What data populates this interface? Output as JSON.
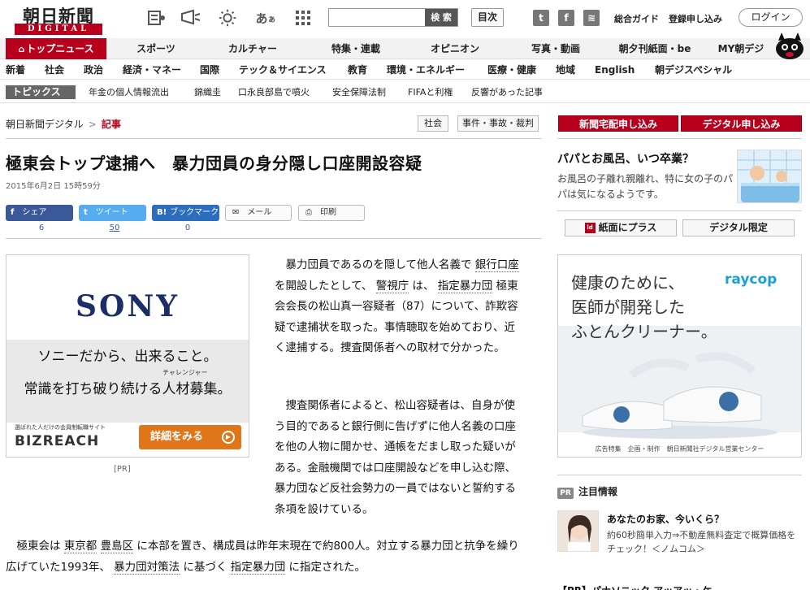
{
  "header": {
    "logo_main": "朝日新聞",
    "logo_sub": "DIGITAL",
    "search_placeholder": "",
    "search_button": "検 索",
    "index_button": "目次",
    "sns_twitter": "t",
    "sns_facebook": "f",
    "sns_rss": "≋",
    "guide_link": "総合ガイド",
    "subscribe_link": "登録申し込み",
    "login_button": "ログイン"
  },
  "main_nav": {
    "items": [
      "トップニュース",
      "スポーツ",
      "カルチャー",
      "特集・連載",
      "オピニオン",
      "写真・動画",
      "朝夕刊紙面・be",
      "MY朝デジ"
    ]
  },
  "sub_nav": {
    "items": [
      "新着",
      "社会",
      "政治",
      "経済・マネー",
      "国際",
      "テック＆サイエンス",
      "教育",
      "環境・エネルギー",
      "医療・健康",
      "地域",
      "English",
      "朝デジスペシャル"
    ]
  },
  "topics": {
    "label": "トピックス",
    "items": [
      "年金の個人情報流出",
      "錦織圭",
      "口永良部島で噴火",
      "安全保障法制",
      "FIFAと利権",
      "反響があった記事"
    ]
  },
  "breadcrumb": {
    "home": "朝日新聞デジタル",
    "separator": ">",
    "current": "記事"
  },
  "categories": [
    "社会",
    "事件・事故・裁判"
  ],
  "article": {
    "headline": "極東会トップ逮捕へ　暴力団員の身分隠し口座開設容疑",
    "date": "2015年6月2日 15時59分",
    "share_fb": "シェア",
    "share_fb_glyph": "f",
    "share_fb_count": "6",
    "share_tw": "ツイート",
    "share_tw_glyph": "t",
    "share_tw_count": "50",
    "share_hb": "ブックマーク",
    "share_hb_glyph": "B!",
    "share_hb_count": "0",
    "mail": "メール",
    "mail_glyph": "✉",
    "print": "印刷",
    "print_glyph": "⎙",
    "p1": [
      {
        "t": "　暴力団員であるのを隠して他人名義で "
      },
      {
        "t": "銀行口座",
        "kw": true
      },
      {
        "t": " を開設したとして、 "
      },
      {
        "t": "警視庁",
        "kw": true
      },
      {
        "t": " は、 "
      },
      {
        "t": "指定暴力団",
        "kw": true
      },
      {
        "t": " 極東会会長の松山真一容疑者（87）について、詐欺容疑で逮捕状を取った。事情聴取を始めており、近く逮捕する。捜査関係者への取材で分かった。"
      }
    ],
    "p2": "　捜査関係者によると、松山容疑者は、自身が使う目的であると銀行側に告げずに他人名義の口座を他の人物に開かせ、通帳をだまし取った疑いがある。金融機関では口座開設などを申し込む際、暴力団など反社会勢力の一員ではないと誓約する条項を設けている。",
    "p3": [
      {
        "t": "　極東会は "
      },
      {
        "t": "東京都",
        "kw": true
      },
      {
        "t": " "
      },
      {
        "t": "豊島区",
        "kw": true
      },
      {
        "t": " に本部を置き、構成員は昨年末現在で約800人。対立する暴力団と抗争を繰り広げていた1993年、 "
      },
      {
        "t": "暴力団対策法",
        "kw": true
      },
      {
        "t": " に基づく "
      },
      {
        "t": "指定暴力団",
        "kw": true
      },
      {
        "t": " に指定された。"
      }
    ]
  },
  "ad_left": {
    "brand": "SONY",
    "line1": "ソニーだから、出来ること。",
    "ruby": "チャレンジャー",
    "line2": "常識を打ち破り続ける人材募集。",
    "biz_small": "選ばれた人だけの会員制転職サイト",
    "biz_logo": "BIZREACH",
    "cta": "詳細をみる",
    "cta_glyph": "▶",
    "pr": "[PR]"
  },
  "right": {
    "btn1": "新聞宅配申し込み",
    "btn2": "デジタル申し込み",
    "feature_title": "パパとお風呂、いつ卒業？",
    "feature_desc": "お風呂の子離れ親離れ、特に女の子のパパは気になるようです。",
    "box1": "紙面にプラス",
    "box1_glyph": "ld",
    "box2": "デジタル限定",
    "ad_line1": "健康のために、",
    "ad_line2": "医師が開発した",
    "ad_line3": "ふとんクリーナー。",
    "ad_brand": "raycop",
    "ad_foot": "広告特集　企画・制作　朝日新聞社デジタル営業センター",
    "attention_pr": "PR",
    "attention_label": "注目情報",
    "attn_title": "あなたのお家、今いくら？",
    "attn_desc": "約60秒簡単入力⇒不動産無料査定で概算価格をチェック！＜ノムコム＞",
    "cut_off": "【PR】パナソニック アッアッ・ケ..."
  },
  "colors": {
    "brand_red": "#b8001c",
    "facebook": "#3b5998",
    "twitter": "#55acee",
    "hatena": "#2c6ebd",
    "cta_orange": "#e0761a",
    "raycop_blue": "#1aa0d8"
  }
}
